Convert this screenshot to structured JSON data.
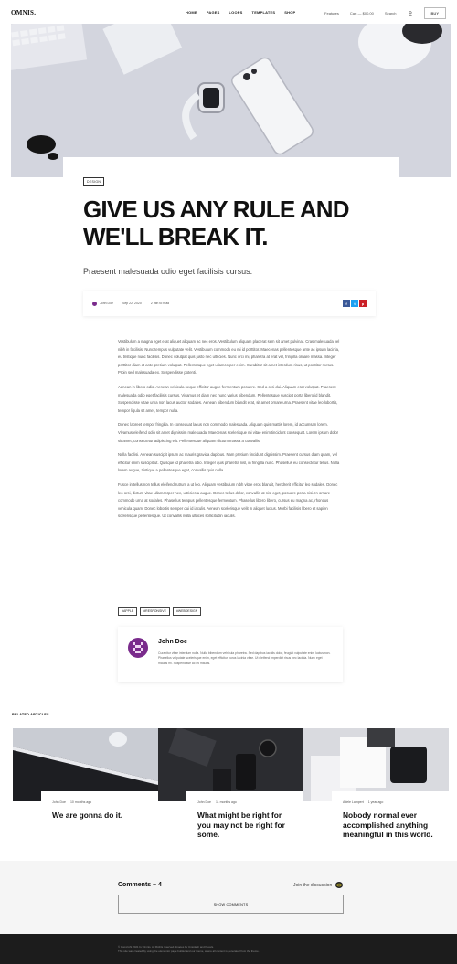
{
  "header": {
    "logo": "OMNIS.",
    "nav": [
      "HOME",
      "PAGES",
      "LOOPS",
      "TEMPLATES",
      "SHOP"
    ],
    "features": "Features",
    "cart": "Cart — $00.00",
    "search": "Search",
    "buy": "BUY"
  },
  "post": {
    "category": "DESIGN",
    "title": "GIVE US ANY RULE AND WE'LL BREAK IT.",
    "subtitle": "Praesent malesuada odio eget facilisis cursus.",
    "author": "John Doe",
    "date": "Sep 22, 2020",
    "read_time": "2 min to read",
    "share": [
      "f",
      "t",
      "p"
    ],
    "paragraphs": [
      "Vestibulum a magna eget erat aliquet aliquam ac nec eros. Vestibulum aliquam placerat sem sit amet pulvinar. Cras malesuada vel nibh in facilisis. Nunc tempus vulputate velit. Vestibulum commodo eu mi id porttitor. Maecenas pellentesque ante ac ipsum lacinia, eu tristique nunc facilisis. Donec volutpat quis justo nec ultricies. Nunc orci mi, pharetra at erat vel, fringilla ornare massa. Integer porttitor diam et ante pretium volutpat. Pellentesque eget ullamcorper enim. Curabitur sit amet interdum risus, ut porttitor metus. Proin sed malesuada ex. Suspendisse potenti.",
      "Aenean in libero odio. Aenean vehicula neque efficitur augue fermentum posuere. Sed a orci dui. Aliquam erat volutpat. Praesent malesuada odio eget facilisis cursus. Vivamus et diam nec nunc varius bibendum. Pellentesque suscipit porta libero id blandit. Suspendisse vitae urna non lacus auctor sodales. Aenean bibendum blandit erat, sit amet ornare urna. Praesent vitae leo lobortis, tempor ligula sit amet, tempor nulla.",
      "Donec laoreet tempor fringilla. In consequat lacus non commodo malesuada. Aliquam quis mattis lorem, id accumsan lorem. Vivamus eleifend odio sit amet dignissim malesuada. Maecenas scelerisque mi vitae enim tincidunt consequat. Lorem ipsum dolor sit amet, consectetur adipiscing elit. Pellentesque aliquam dictum massa a convallis.",
      "Nulla facilisi. Aenean suscipit ipsum ac mauris gravida dapibus. Nam pretium tincidunt dignissim. Praesent cursus diam quam, vel efficitur enim suscipit ut. Quisque id pharetra odio. Integer quis pharetra nisl, in fringilla nunc. Phasellus eu consectetur tellus. Nulla lorem augue, tristique a pellentesque eget, convallis quis nulla.",
      "Fusce in tellus non tellus eleifend rutrum a ut leo. Aliquam vestibulum nibh vitae eros blandit, hendrerit efficitur leo sodales. Donec leo orci, dictum vitae ullamcorper nec, ultricies a augue. Donec tellus dolor, convallis at nisl eget, posuere porta nisi. In ornare commodo urna at sodales. Phasellus tempus pellentesque fermentum. Phasellus libero libero, cursus eu magna ac, rhoncus vehicula quam. Donec lobortis semper dui id iaculis. Aenean scelerisque velit in aliquet luctus. Morbi facilisis libero et sapien scelerisque pellentesque. Ut convallis nulla ultrices sollicitudin iaculis."
    ],
    "tags": [
      "#APPLE",
      "#RESPONSIVE",
      "#WEBDESIGN"
    ]
  },
  "author_box": {
    "name": "John Doe",
    "bio": "Curabitur vitae interdum nulla. Nulla bibendum vehicula pharetra. Sed dapibus iaculis dolor, feugiat vulputate enim luctus non. Phasellus vulputate scelerisque enim, eget efficitur purus lacinia vitae. Ut eleifend imperdiet risus nec lacinia. Nunc eget mauris mi. Suspendisse ac mi mauris."
  },
  "related": {
    "label": "RELATED ARTICLES",
    "items": [
      {
        "author": "John Doe",
        "ago": "10 months ago",
        "title": "We are gonna do it."
      },
      {
        "author": "John Doe",
        "ago": "11 months ago",
        "title": "What might be right for you may not be right for some."
      },
      {
        "author": "Adele Lampert",
        "ago": "1 year ago",
        "title": "Nobody normal ever accomplished anything meaningful in this world."
      }
    ]
  },
  "comments": {
    "title": "Comments – 4",
    "join": "Join the discussion",
    "button": "SHOW COMMENTS"
  },
  "footer": {
    "line1": "© Copyright 2021 by Omnis. All Rights reserved. Images by Unsplash and Pexels.",
    "line2": "This site was created by using the elementor page builder and our theme, where all content is generated from the theme."
  },
  "colors": {
    "accent": "#7a2b8c",
    "footer_bg": "#1c1c1c",
    "comments_bg": "#f5f5f5",
    "facebook": "#3b5998",
    "twitter": "#1da1f2",
    "pinterest": "#cb2027"
  }
}
